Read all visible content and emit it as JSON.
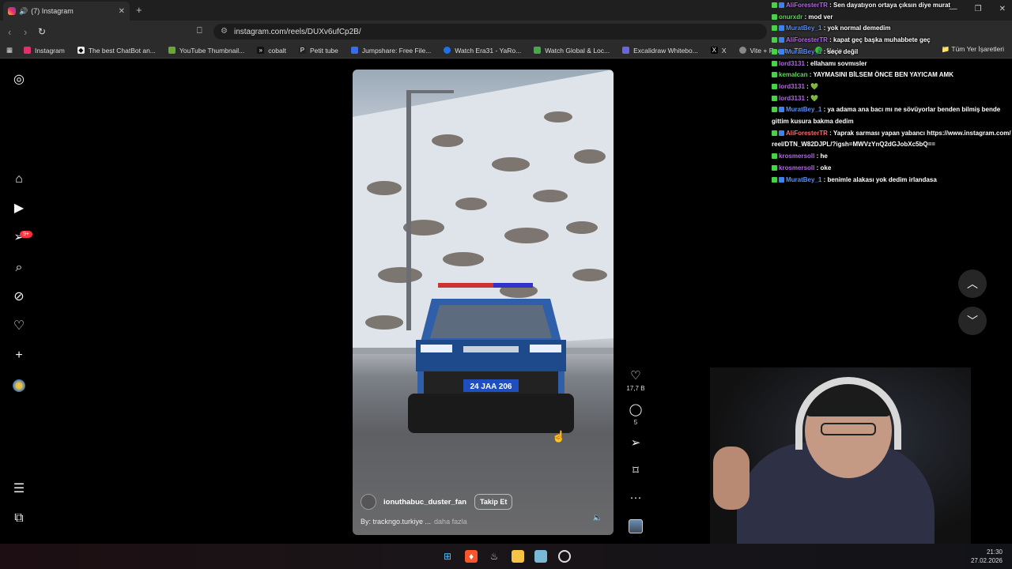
{
  "browser": {
    "tab_title": "(7) Instagram",
    "url": "instagram.com/reels/DUXv6ufCp2B/",
    "bookmarks": [
      "Instagram",
      "The best ChatBot an...",
      "YouTube Thumbnail...",
      "cobalt",
      "Petit tube",
      "Jumpshare: Free File...",
      "Watch Era31 - YaRo...",
      "Watch Global & Loc...",
      "Excalidraw Whitebo...",
      "X",
      "Vite + React + TS",
      "file.io"
    ],
    "bookmarks_all": "Tüm Yer İşaretleri",
    "accent": "#e3306c"
  },
  "sidebar": {
    "icons": [
      "instagram-icon",
      "home-icon",
      "reels-icon",
      "direct-icon",
      "search-icon",
      "explore-icon",
      "heart-icon",
      "create-icon",
      "profile-avatar",
      "menu-icon",
      "meta-icon"
    ],
    "notification_badge": "9+"
  },
  "reel": {
    "plate": "24 JAA 206",
    "username": "ionuthabuc_duster_fan",
    "follow_label": "Takip Et",
    "caption": "By: trackngo.turkiye ...",
    "more_label": "daha fazla",
    "likes": "17,7 B",
    "comments": "5"
  },
  "chat": [
    {
      "user": "AliForesterTR",
      "color": "purple",
      "msg": ": Sen dayatıyon ortaya çıksın diye murat"
    },
    {
      "user": "onurxdr",
      "color": "green",
      "msg": ": mod ver"
    },
    {
      "user": "MuratBey_1",
      "color": "blue",
      "msg": ": yok normal demedim"
    },
    {
      "user": "AliForesterTR",
      "color": "purple",
      "msg": ": kapat geç başka muhabbete geç"
    },
    {
      "user": "MuratBey_1",
      "color": "blue",
      "msg": ": seçe değil"
    },
    {
      "user": "lord3131",
      "color": "purple",
      "msg": ": ellahamı sovmısler"
    },
    {
      "user": "kemalcan",
      "color": "green",
      "msg": ": YAYMASINI BİLSEM ÖNCE BEN YAYICAM AMK"
    },
    {
      "user": "lord3131",
      "color": "purple",
      "msg": ": 💚"
    },
    {
      "user": "lord3131",
      "color": "purple",
      "msg": ": 💚"
    },
    {
      "user": "MuratBey_1",
      "color": "blue",
      "msg": ": ya adama ana bacı mı ne sövüyorlar benden bilmiş bende gittim kusura bakma dedim"
    },
    {
      "user": "AliForesterTR",
      "color": "purple",
      "msg": ": Yaprak sarması yapan yabancı https://www.instagram.com/reel/DTN_W82DJPL/?igsh=MWVzYnQ2dGJobXc5bQ=="
    },
    {
      "user": "krosmersoll",
      "color": "purple",
      "msg": ": he"
    },
    {
      "user": "krosmersoll",
      "color": "purple",
      "msg": ": oke"
    },
    {
      "user": "MuratBey_1",
      "color": "blue",
      "msg": ": benimle alakası yok dedim irlandasa"
    }
  ],
  "taskbar": {
    "time": "21:30",
    "date": "27.02.2026"
  }
}
